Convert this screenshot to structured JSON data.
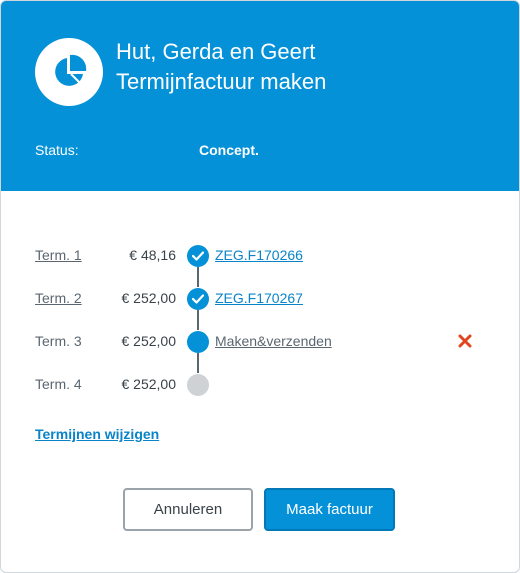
{
  "header": {
    "title_line1": "Hut, Gerda en Geert",
    "title_line2": "Termijnfactuur maken",
    "status_label": "Status:",
    "status_value": "Concept.",
    "icon": "pie-chart-icon",
    "background_color": "#0591d8"
  },
  "terms": [
    {
      "label": "Term. 1",
      "amount": "€ 48,16",
      "reference": "ZEG.F170266",
      "state": "completed"
    },
    {
      "label": "Term. 2",
      "amount": "€ 252,00",
      "reference": "ZEG.F170267",
      "state": "completed"
    },
    {
      "label": "Term. 3",
      "amount": "€ 252,00",
      "reference": "Maken&verzenden",
      "state": "current"
    },
    {
      "label": "Term. 4",
      "amount": "€ 252,00",
      "reference": "",
      "state": "pending"
    }
  ],
  "change_terms_link": "Termijnen wijzigen",
  "buttons": {
    "cancel": "Annuleren",
    "submit": "Maak factuur"
  },
  "colors": {
    "accent": "#0591d8",
    "remove": "#e0451f",
    "pending": "#cfd2d4"
  }
}
